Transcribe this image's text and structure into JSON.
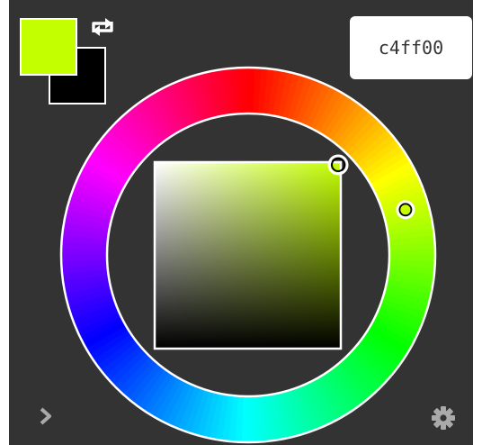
{
  "color": {
    "hex": "c4ff00",
    "foreground": "#c4ff00",
    "background": "#000000",
    "hue_degrees": 74,
    "saturation": 1.0,
    "value": 1.0
  },
  "ui": {
    "panel_bg": "#333333",
    "outline": "#ffffff"
  },
  "icons": {
    "swap": "swap-colors-icon",
    "expand": "chevron-right-icon",
    "settings": "gear-icon"
  }
}
